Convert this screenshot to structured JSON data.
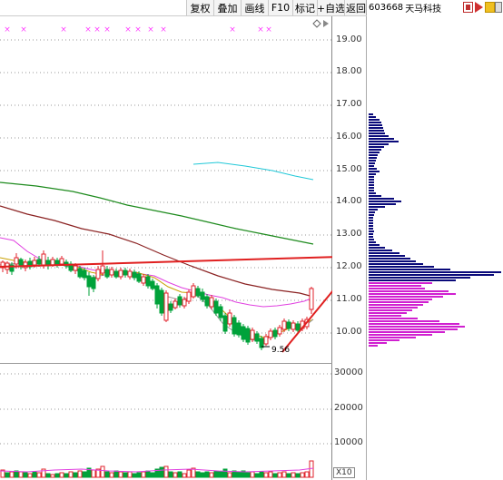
{
  "toolbar": {
    "buttons": [
      "复权",
      "叠加",
      "画线",
      "F10",
      "标记",
      "+自选",
      "返回"
    ]
  },
  "stock": {
    "code": "603668",
    "name": "天马科技"
  },
  "price_axis": {
    "labels": [
      "19.00",
      "18.00",
      "17.00",
      "16.00",
      "15.00",
      "14.00",
      "13.00",
      "12.00",
      "11.00",
      "10.00"
    ]
  },
  "volume_axis": {
    "labels": [
      "30000",
      "20000",
      "10000"
    ],
    "multiplier": "X10"
  },
  "annotations": {
    "low_price": "9.56"
  },
  "colors": {
    "up": "#e0222b",
    "down": "#00a23a",
    "ma5": "#999999",
    "ma10": "#c8a000",
    "ma20": "#e040e0",
    "ma60": "#8b2222",
    "ma120": "#1e8b1e",
    "ma250": "#20c8d8",
    "chip_profit": "#d020d0",
    "chip_loss": "#0a0a7a",
    "arrow": "#e02020"
  },
  "markers": {
    "symbol": "×",
    "color": "#ff40ff"
  }
}
